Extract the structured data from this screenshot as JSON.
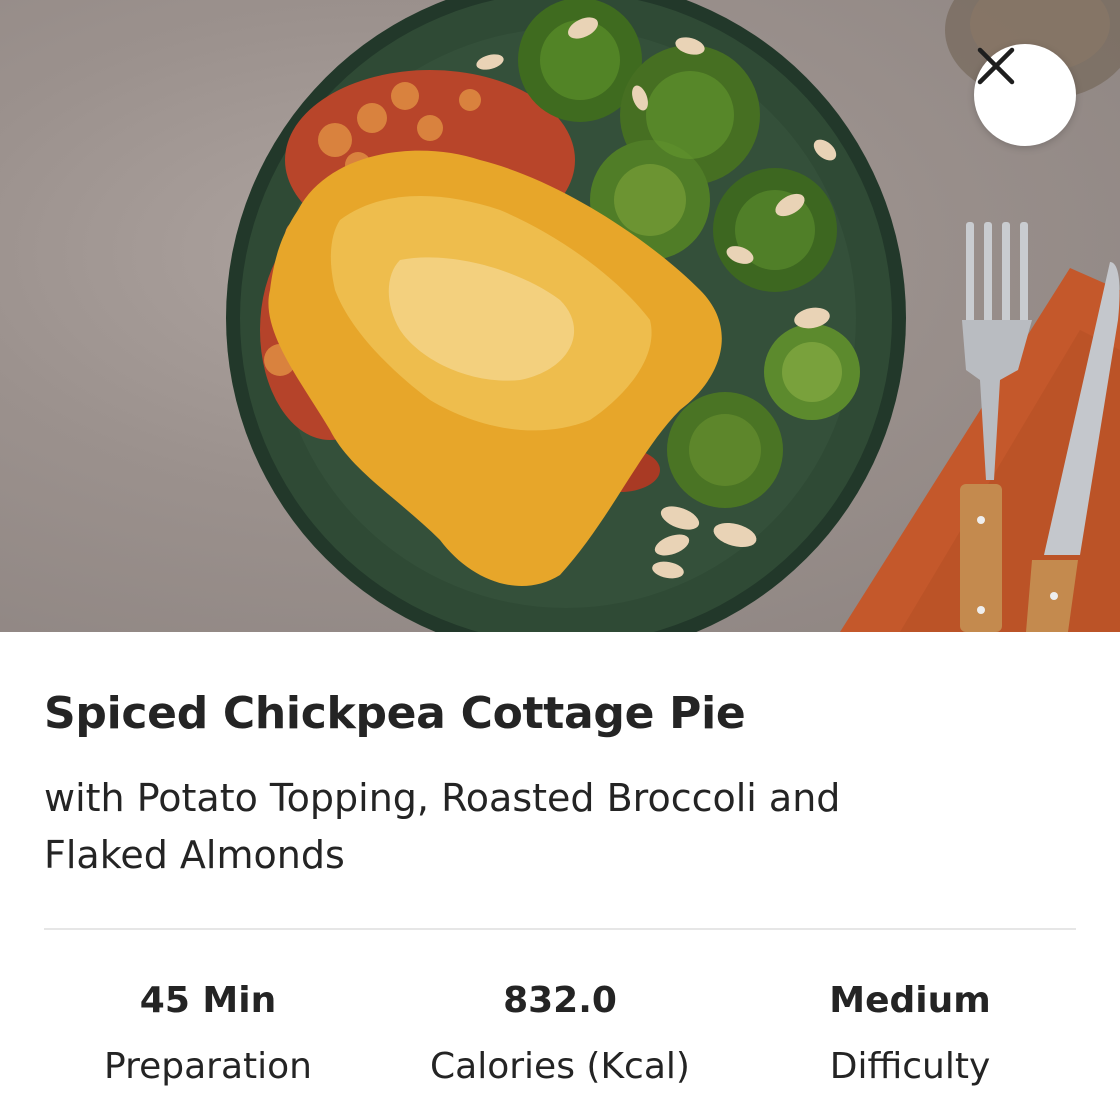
{
  "recipe": {
    "title": "Spiced Chickpea Cottage Pie",
    "subtitle": "with Potato Topping, Roasted Broccoli and Flaked Almonds"
  },
  "stats": [
    {
      "value": "45 Min",
      "label": "Preparation"
    },
    {
      "value": "832.0",
      "label": "Calories (Kcal)"
    },
    {
      "value": "Medium",
      "label": "Difficulty"
    }
  ],
  "icons": {
    "close": "close-icon"
  },
  "colors": {
    "background": "#ffffff",
    "text": "#242424",
    "divider": "#e6e6e6",
    "plate": "#2e4532",
    "napkin": "#c4582b"
  }
}
